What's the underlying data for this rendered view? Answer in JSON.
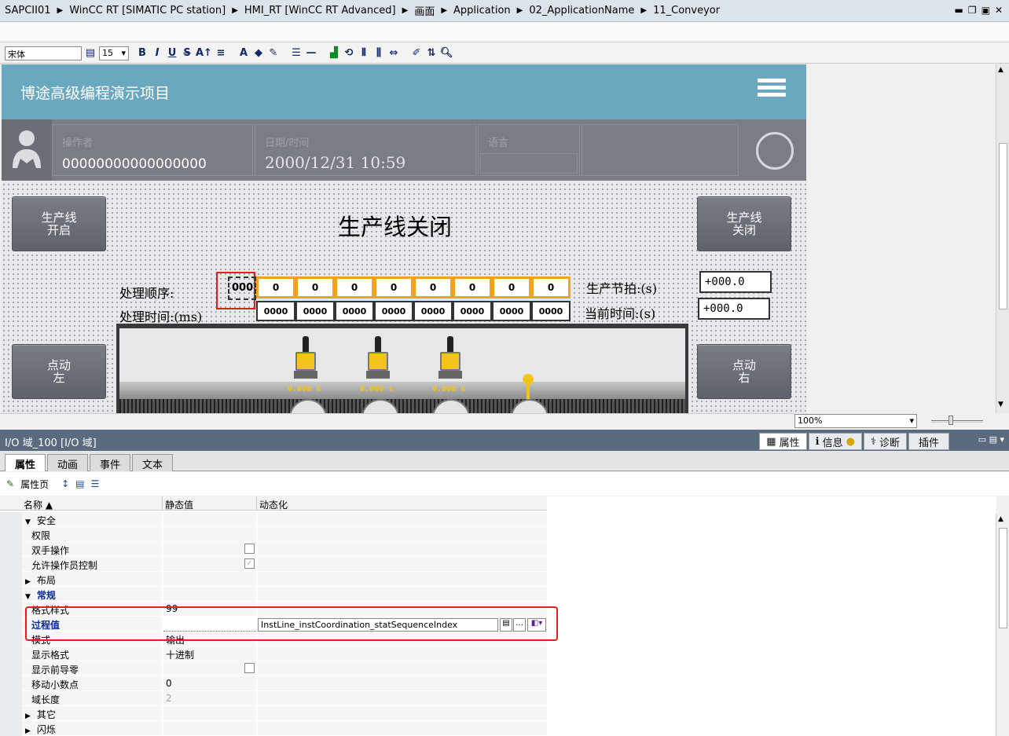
{
  "breadcrumb": [
    "SAPCII01",
    "WinCC RT [SIMATIC PC station]",
    "HMI_RT [WinCC RT Advanced]",
    "画面",
    "Application",
    "02_ApplicationName",
    "11_Conveyor"
  ],
  "toolbar": {
    "font_name": "宋体",
    "font_size": "15",
    "bold": "B",
    "italic": "I",
    "underline": "U",
    "strike": "S"
  },
  "hmi": {
    "title": "博途高级编程演示项目",
    "operator_label": "操作者",
    "operator_value": "00000000000000000",
    "datetime_label": "日期/时间",
    "datetime_value": "2000/12/31  10:59",
    "language_label": "语言",
    "status_title": "生产线关闭",
    "btn_line_on": "生产线\n开启",
    "btn_line_off": "生产线\n关闭",
    "btn_jog_left": "点动\n左",
    "btn_jog_right": "点动\n右",
    "seq_label": "处理顺序:",
    "time_label": "处理时间:(ms)",
    "selected_io": "000",
    "seq_values": [
      "0",
      "0",
      "0",
      "0",
      "0",
      "0",
      "0",
      "0"
    ],
    "time_values": [
      "0000",
      "0000",
      "0000",
      "0000",
      "0000",
      "0000",
      "0000",
      "0000"
    ],
    "takt_label": "生产节拍:(s)",
    "takt_value": "+000.0",
    "current_label": "当前时间:(s)",
    "current_value": "+000.0",
    "sensor_values": [
      "0.000  s",
      "0.000  s",
      "0.000  s"
    ]
  },
  "zoom": {
    "value": "100%"
  },
  "inspector": {
    "title": "I/O 域_100 [I/O 域]",
    "right_tabs": [
      "属性",
      "信息",
      "诊断",
      "插件"
    ],
    "tabs": [
      "属性",
      "动画",
      "事件",
      "文本"
    ],
    "sub_label": "属性页",
    "columns": [
      "名称",
      "静态值",
      "动态化"
    ],
    "rows": [
      {
        "name": "安全",
        "value": "",
        "expand": "▼",
        "bold": false
      },
      {
        "name": "权限",
        "value": "",
        "indent": true
      },
      {
        "name": "双手操作",
        "value": "",
        "indent": true,
        "check": false
      },
      {
        "name": "允许操作员控制",
        "value": "",
        "indent": true,
        "check": true
      },
      {
        "name": "布局",
        "value": "",
        "expand": "▶"
      },
      {
        "name": "常规",
        "value": "",
        "expand": "▼",
        "bold": true
      },
      {
        "name": "格式样式",
        "value": "99",
        "indent": true
      },
      {
        "name": "过程值",
        "value": "",
        "indent": true,
        "bold": true,
        "tag": "InstLine_instCoordination_statSequenceIndex"
      },
      {
        "name": "模式",
        "value": "输出",
        "indent": true
      },
      {
        "name": "显示格式",
        "value": "十进制",
        "indent": true
      },
      {
        "name": "显示前导零",
        "value": "",
        "indent": true,
        "check": false
      },
      {
        "name": "移动小数点",
        "value": "0",
        "indent": true
      },
      {
        "name": "域长度",
        "value": "2",
        "indent": true,
        "grey": true
      },
      {
        "name": "其它",
        "value": "",
        "expand": "▶"
      },
      {
        "name": "闪烁",
        "value": "",
        "expand": "▶"
      }
    ]
  }
}
